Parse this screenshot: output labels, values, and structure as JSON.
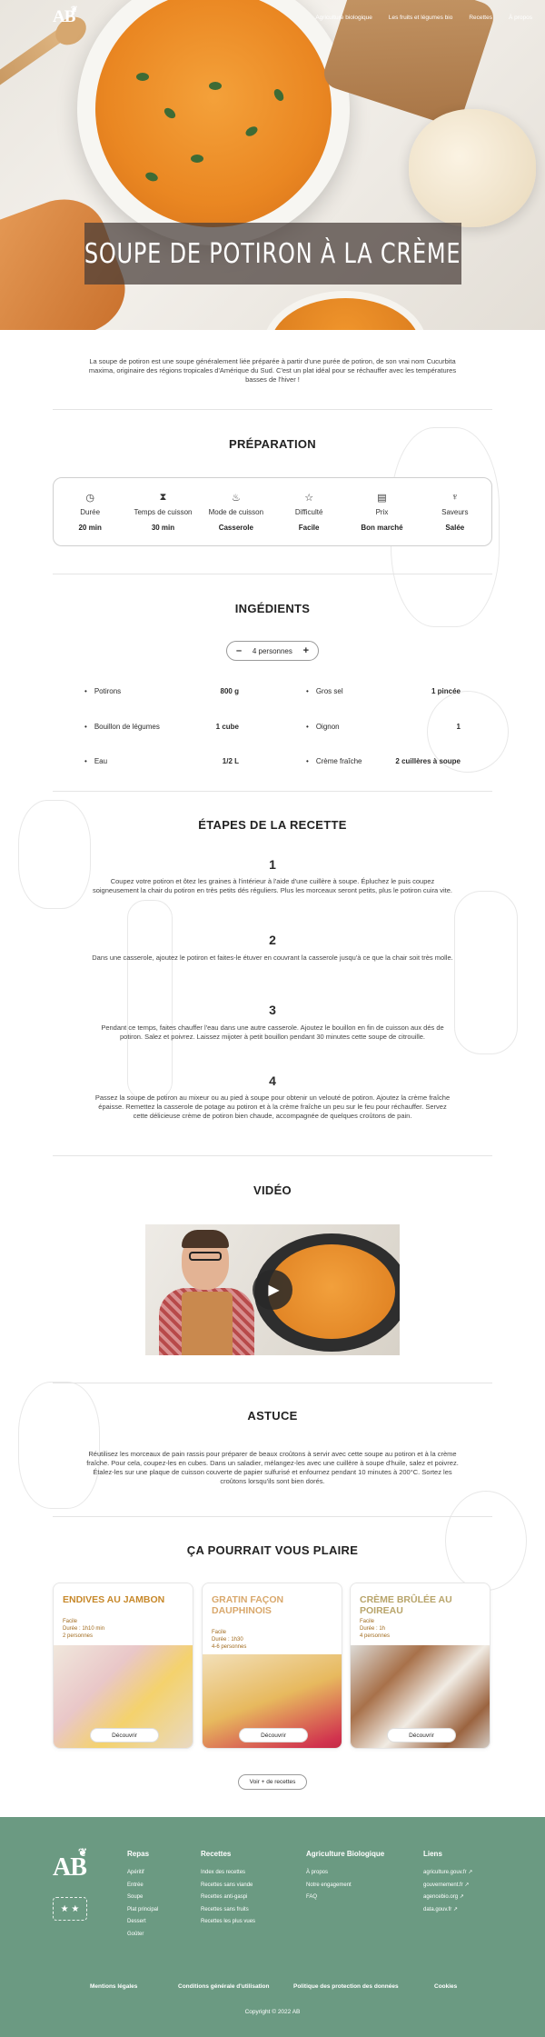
{
  "nav": {
    "logo": "AB",
    "items": [
      "Agriculture biologique",
      "Les fruits et légumes bio",
      "Recettes",
      "À propos"
    ]
  },
  "hero": {
    "title": "Soupe de potiron à la crème"
  },
  "intro": "La soupe de potiron est une soupe généralement liée préparée à partir d'une purée de potiron, de son vrai nom Cucurbita maxima, originaire des régions tropicales d'Amérique du Sud. C'est un plat idéal pour se réchauffer avec les températures basses de l'hiver !",
  "preparation": {
    "title": "PRÉPARATION",
    "items": [
      {
        "icon": "clock-icon",
        "label": "Durée",
        "value": "20 min"
      },
      {
        "icon": "hourglass-icon",
        "label": "Temps de cuisson",
        "value": "30 min"
      },
      {
        "icon": "pot-icon",
        "label": "Mode de cuisson",
        "value": "Casserole"
      },
      {
        "icon": "star-icon",
        "label": "Difficulté",
        "value": "Facile"
      },
      {
        "icon": "money-icon",
        "label": "Prix",
        "value": "Bon marché"
      },
      {
        "icon": "flavor-icon",
        "label": "Saveurs",
        "value": "Salée"
      }
    ]
  },
  "ingredients": {
    "title": "INGÉDIENTS",
    "persons": "4 personnes",
    "minus": "–",
    "plus": "+",
    "left": [
      {
        "name": "Potirons",
        "qty": "800 g"
      },
      {
        "name": "Bouillon de légumes",
        "qty": "1 cube"
      },
      {
        "name": "Eau",
        "qty": "1/2 L"
      }
    ],
    "right": [
      {
        "name": "Gros sel",
        "qty": "1 pincée"
      },
      {
        "name": "Oignon",
        "qty": "1"
      },
      {
        "name": "Crème fraîche",
        "qty": "2 cuillères à soupe"
      }
    ]
  },
  "steps": {
    "title": "ÉTAPES DE LA RECETTE",
    "items": [
      {
        "num": "1",
        "text": "Coupez votre potiron et ôtez les graines à l'intérieur à l'aide d'une cuillère à soupe. Épluchez le puis coupez soigneusement la chair du potiron en très petits dés réguliers. Plus les morceaux seront petits, plus le potiron cuira vite."
      },
      {
        "num": "2",
        "text": "Dans une casserole, ajoutez le potiron et faites-le étuver en couvrant la casserole jusqu'à ce que la chair soit très molle."
      },
      {
        "num": "3",
        "text": "Pendant ce temps, faites chauffer l'eau dans une autre casserole. Ajoutez le bouillon en fin de cuisson aux dés de potiron. Salez et poivrez. Laissez mijoter à petit bouillon pendant 30 minutes cette soupe de citrouille."
      },
      {
        "num": "4",
        "text": "Passez la soupe de potiron au mixeur ou au pied à soupe pour obtenir un velouté de potiron. Ajoutez la crème fraîche épaisse. Remettez la casserole de potage au potiron et à la crème fraîche un peu sur le feu pour réchauffer. Servez cette délicieuse crème de potiron bien chaude, accompagnée de quelques croûtons de pain."
      }
    ]
  },
  "video": {
    "title": "VIDÉO"
  },
  "astuce": {
    "title": "ASTUCE",
    "text": "Réutilisez les morceaux de pain rassis pour préparer de beaux croûtons à servir avec cette soupe au potiron et à la crème fraîche. Pour cela, coupez-les en cubes. Dans un saladier, mélangez-les avec une cuillère à soupe d'huile, salez et poivrez. Étalez-les sur une plaque de cuisson couverte de papier sulfurisé et enfournez pendant 10 minutes à 200°C. Sortez les croûtons lorsqu'ils sont bien dorés."
  },
  "related": {
    "title": "ÇA POURRAIT VOUS PLAIRE",
    "cards": [
      {
        "title": "Endives au jambon",
        "color": "#c7882a",
        "l1": "Facile",
        "l2": "Durée : 1h10 min",
        "l3": "2 personnes",
        "button": "Découvrir"
      },
      {
        "title": "Gratin façon dauphinois",
        "color": "#d9a86c",
        "l1": "Facile",
        "l2": "Durée : 1h30",
        "l3": "4-6 personnes",
        "button": "Découvrir"
      },
      {
        "title": "Crème brûlée au poireau",
        "color": "#b8a46a",
        "l1": "Facile",
        "l2": "Durée : 1h",
        "l3": "4 personnes",
        "button": "Découvrir"
      }
    ],
    "more": "Voir + de recettes"
  },
  "footer": {
    "logo": "AB",
    "euro_label": "★ ★",
    "columns": [
      {
        "title": "Repas",
        "links": [
          "Apéritif",
          "Entrée",
          "Soupe",
          "Plat principal",
          "Dessert",
          "Goûter"
        ]
      },
      {
        "title": "Recettes",
        "links": [
          "Index des recettes",
          "Recettes sans viande",
          "Recettes anti-gaspi",
          "Recettes sans fruits",
          "Recettes les plus vues"
        ]
      },
      {
        "title": "Agriculture Biologique",
        "links": [
          "À propos",
          "Notre engagement",
          "FAQ"
        ]
      },
      {
        "title": "Liens",
        "links": [
          "agriculture.gouv.fr ↗",
          "gouvernement.fr ↗",
          "agencebio.org ↗",
          "data.gouv.fr ↗"
        ]
      }
    ],
    "legal": [
      "Mentions légales",
      "Conditions générale d'utilisation",
      "Politique des protection des données",
      "Cookies"
    ],
    "copyright": "Copyright © 2022 AB"
  }
}
